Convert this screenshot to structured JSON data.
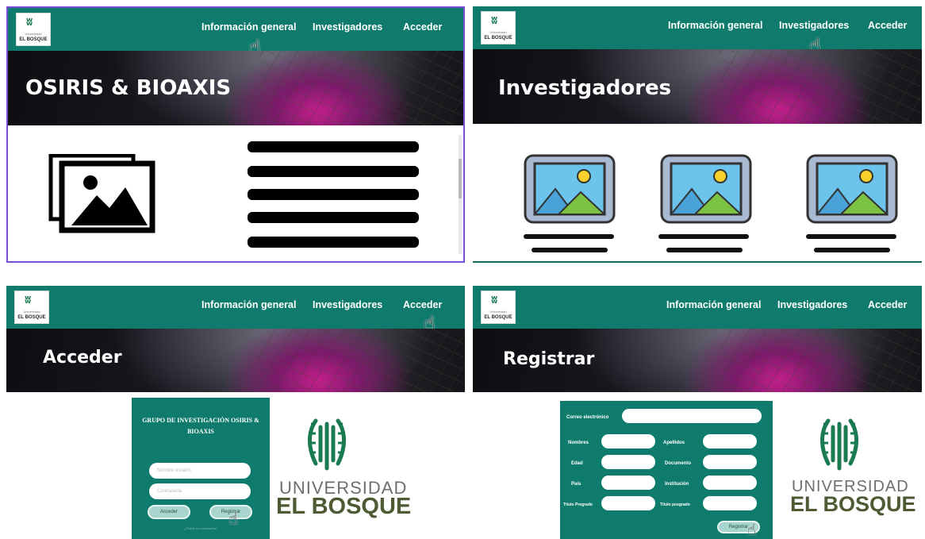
{
  "nav": {
    "info": "Información general",
    "researchers": "Investigadores",
    "login": "Acceder"
  },
  "logo": {
    "small": "Universidad",
    "name": "EL BOSQUE"
  },
  "panel1": {
    "banner_title": "OSIRIS & BIOAXIS"
  },
  "panel2": {
    "banner_title": "Investigadores"
  },
  "panel3": {
    "banner_title": "Acceder",
    "form_title": "GRUPO DE INVESTIGACIÓN OSIRIS & BIOAXIS",
    "username_placeholder": "Nombre usuario",
    "password_placeholder": "Contraseña",
    "login_button": "Acceder",
    "register_button": "Registrar",
    "forgot_link": "¿Olvidó su contraseña?"
  },
  "panel4": {
    "banner_title": "Registrar",
    "email_label": "Correo electrónico",
    "names_label": "Nombres",
    "surnames_label": "Apellidos",
    "age_label": "Edad",
    "document_label": "Documento",
    "country_label": "País",
    "institution_label": "Institución",
    "undergrad_label": "Título Pregrado",
    "postgrad_label": "Título posgrado",
    "register_button": "Registrar"
  },
  "university": {
    "word": "UNIVERSIDAD",
    "name": "EL BOSQUE"
  },
  "colors": {
    "brand_green": "#0f7b6c",
    "panel_border": "#7a4fd8",
    "button_fill": "#a8d6cf"
  }
}
